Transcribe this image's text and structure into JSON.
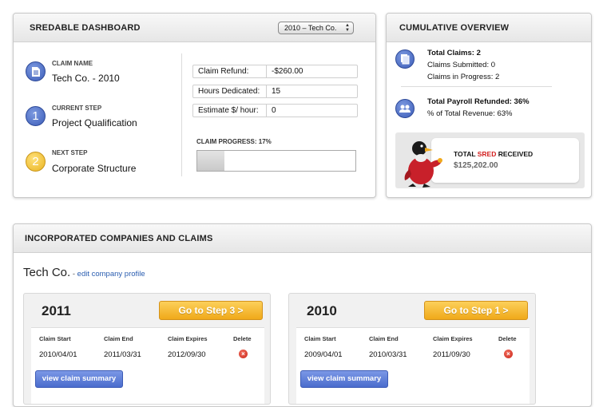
{
  "dashboard": {
    "title": "SREDABLE DASHBOARD",
    "company_select": "2010 – Tech Co.",
    "claim_name_label": "CLAIM NAME",
    "claim_name": "Tech Co. - 2010",
    "current_step_label": "CURRENT STEP",
    "current_step_number": "1",
    "current_step": "Project Qualification",
    "next_step_label": "NEXT STEP",
    "next_step_number": "2",
    "next_step": "Corporate Structure",
    "fields": [
      {
        "label": "Claim Refund:",
        "value": "-$260.00"
      },
      {
        "label": "Hours Dedicated:",
        "value": "15"
      },
      {
        "label": "Estimate $/ hour:",
        "value": "0"
      }
    ],
    "progress_label": "CLAIM PROGRESS: 17%",
    "progress_fraction": 0.17
  },
  "overview": {
    "title": "CUMULATIVE OVERVIEW",
    "total_claims": "Total Claims: 2",
    "claims_submitted": "Claims Submitted: 0",
    "claims_in_progress": "Claims in Progress: 2",
    "payroll_refunded": "Total Payroll Refunded: 36%",
    "pct_revenue": "% of Total Revenue: 63%",
    "sred_prefix": "TOTAL ",
    "sred_word": "SRED",
    "sred_suffix": " RECEIVED",
    "sred_amount": "$125,202.00"
  },
  "companies": {
    "title": "INCORPORATED COMPANIES AND CLAIMS",
    "company_name": "Tech Co.",
    "separator": " - ",
    "edit_link": "edit company profile",
    "columns": [
      "Claim Start",
      "Claim End",
      "Claim Expires",
      "Delete"
    ],
    "summary_button": "view claim summary",
    "claims": [
      {
        "year": "2011",
        "step_button": "Go to Step 3 >",
        "start": "2010/04/01",
        "end": "2011/03/31",
        "expires": "2012/09/30"
      },
      {
        "year": "2010",
        "step_button": "Go to Step 1 >",
        "start": "2009/04/01",
        "end": "2010/03/31",
        "expires": "2011/09/30"
      }
    ]
  },
  "colors": {
    "accent_blue": "#3b5cb8",
    "accent_yellow": "#f0a91a",
    "sred_red": "#d21f1f",
    "link": "#2a5db0"
  },
  "icons": [
    "document-icon",
    "step-number-icon",
    "documents-icon",
    "group-icon",
    "penguin-mascot",
    "delete-icon",
    "chevron-updown-icon"
  ]
}
